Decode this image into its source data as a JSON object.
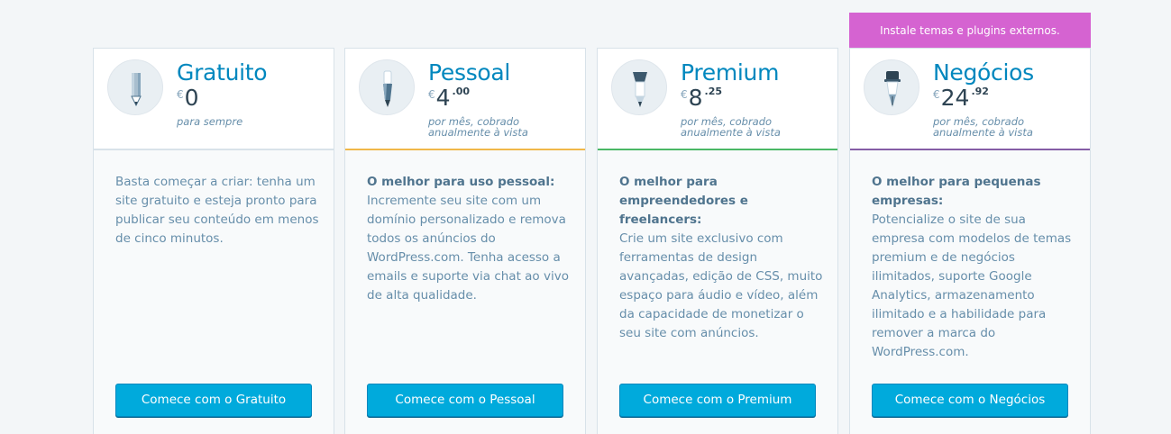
{
  "ribbon": {
    "text": "Instale temas e plugins externos."
  },
  "colors": {
    "accent": "#0087be",
    "button": "#00aadc",
    "ribbon": "#d563d1",
    "pessoal_border": "#f0b849",
    "premium_border": "#4ab866",
    "negocios_border": "#855da6"
  },
  "plans": [
    {
      "name": "Gratuito",
      "icon": "pencil-icon",
      "currency": "€",
      "price_int": "0",
      "price_dec": "",
      "period": "para sempre",
      "desc_bold": "",
      "description": "Basta começar a criar: tenha um site gratuito e esteja pronto para publicar seu conteúdo em menos de cinco minutos.",
      "button": "Comece com o Gratuito"
    },
    {
      "name": "Pessoal",
      "icon": "pen-icon",
      "currency": "€",
      "price_int": "4",
      "price_dec": ".00",
      "period": "por mês, cobrado anualmente à vista",
      "desc_bold": "O melhor para uso pessoal:",
      "description": "Incremente seu site com um domínio personalizado e remova todos os anúncios do WordPress.com. Tenha acesso a emails e suporte via chat ao vivo de alta qualidade.",
      "button": "Comece com o Pessoal"
    },
    {
      "name": "Premium",
      "icon": "brush-icon",
      "currency": "€",
      "price_int": "8",
      "price_dec": ".25",
      "period": "por mês, cobrado anualmente à vista",
      "desc_bold": "O melhor para empreendedores e freelancers:",
      "description": "Crie um site exclusivo com ferramentas de design avançadas, edição de CSS, muito espaço para áudio e vídeo, além da capacidade de monetizar o seu site com anúncios.",
      "button": "Comece com o Premium"
    },
    {
      "name": "Negócios",
      "icon": "fountain-pen-icon",
      "currency": "€",
      "price_int": "24",
      "price_dec": ".92",
      "period": "por mês, cobrado anualmente à vista",
      "desc_bold": "O melhor para pequenas empresas:",
      "description": "Potencialize o site de sua empresa com modelos de temas premium e de negócios ilimitados, suporte Google Analytics, armazenamento ilimitado e a habilidade para remover a marca do WordPress.com.",
      "button": "Comece com o Negócios"
    }
  ]
}
